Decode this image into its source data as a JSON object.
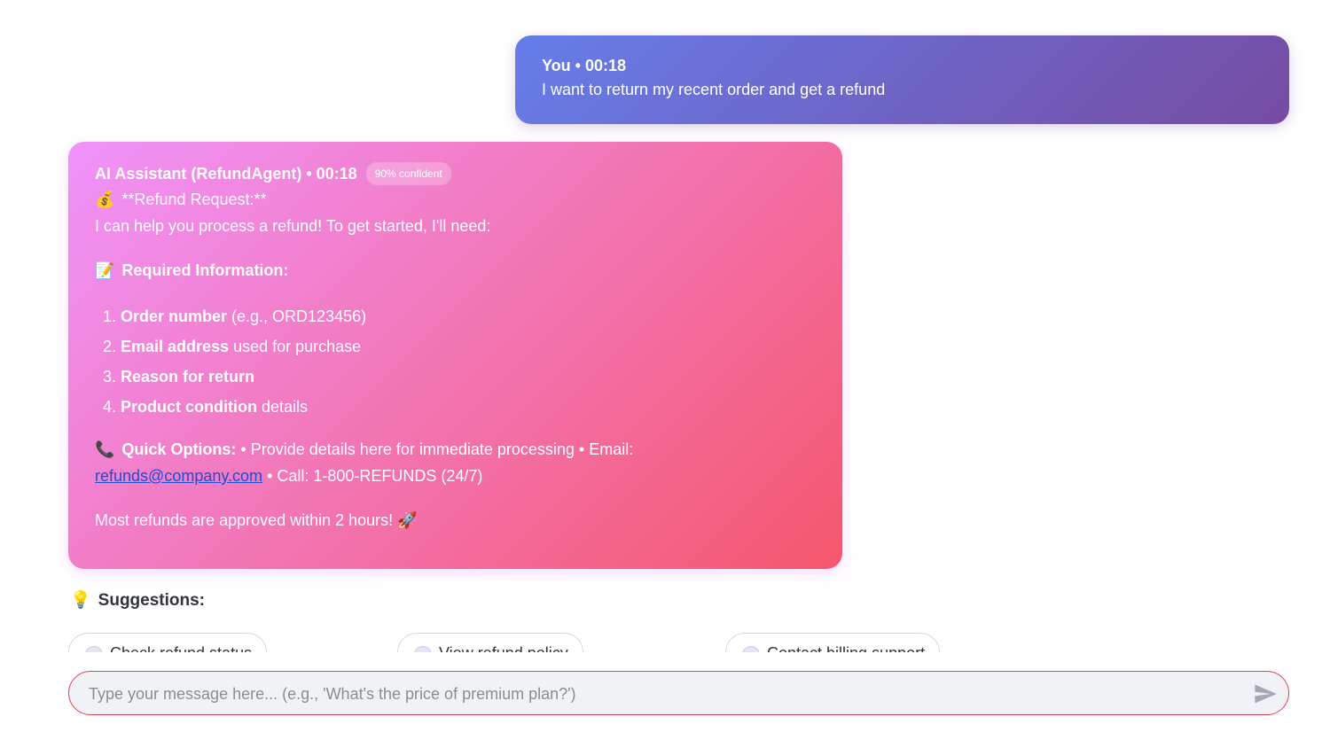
{
  "user_message": {
    "header": "You • 00:18",
    "text": "I want to return my recent order and get a refund"
  },
  "ai_message": {
    "header": "AI Assistant (RefundAgent) • 00:18",
    "confidence": "90% confident",
    "title_emoji": "💰",
    "title": "**Refund Request:**",
    "intro": "I can help you process a refund! To get started, I'll need:",
    "required_emoji": "📝",
    "required_title": "Required Information:",
    "required_items": [
      {
        "bold": "Order number",
        "rest": " (e.g., ORD123456)"
      },
      {
        "bold": "Email address",
        "rest": " used for purchase"
      },
      {
        "bold": "Reason for return",
        "rest": ""
      },
      {
        "bold": "Product condition",
        "rest": " details"
      }
    ],
    "quick_emoji": "📞",
    "quick_title": "Quick Options:",
    "quick_text_1": " • Provide details here for immediate processing • Email:",
    "email": "refunds@company.com",
    "quick_text_2": " • Call: 1-800-REFUNDS (24/7)",
    "closing": "Most refunds are approved within 2 hours!",
    "closing_emoji": "🚀"
  },
  "suggestions": {
    "emoji": "💡",
    "title": "Suggestions:",
    "items": [
      "Check refund status",
      "View refund policy",
      "Contact billing support"
    ]
  },
  "input": {
    "placeholder": "Type your message here... (e.g., 'What's the price of premium plan?')",
    "value": ""
  },
  "colors": {
    "user_gradient": [
      "#667eea",
      "#764ba2"
    ],
    "ai_gradient": [
      "#f093fb",
      "#f5576c"
    ],
    "input_border": "#e0454f"
  }
}
